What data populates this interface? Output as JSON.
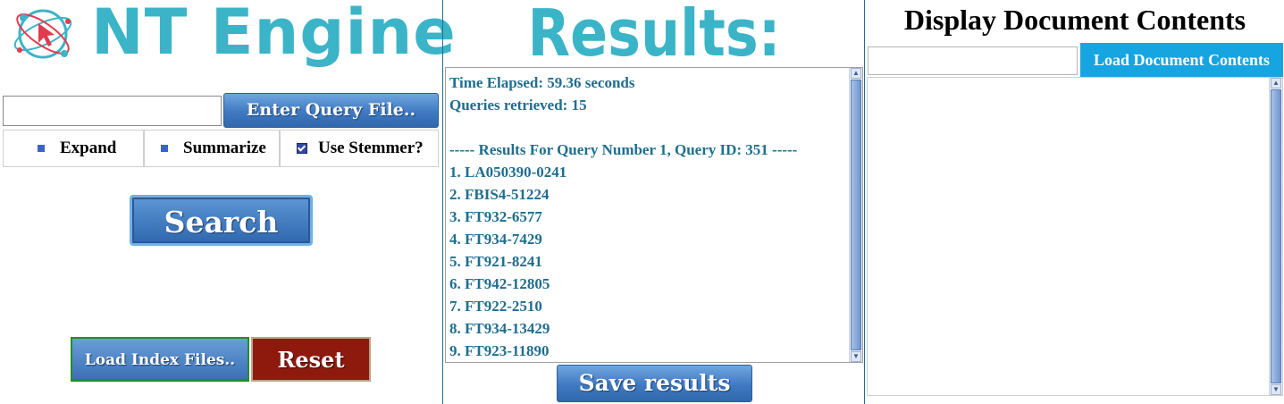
{
  "left": {
    "brand": "NT Engine",
    "query_placeholder": "",
    "enter_query_label": "Enter Query File..",
    "options": [
      {
        "label": "Expand",
        "checked": false
      },
      {
        "label": "Summarize",
        "checked": false
      },
      {
        "label": "Use Stemmer?",
        "checked": true
      }
    ],
    "search_label": "Search",
    "load_index_label": "Load Index Files..",
    "reset_label": "Reset"
  },
  "middle": {
    "title": "Results:",
    "results_lines": [
      "Time Elapsed: 59.36 seconds",
      "Queries retrieved: 15",
      "",
      "----- Results For Query Number 1, Query ID: 351 -----",
      "1. LA050390-0241",
      "2. FBIS4-51224",
      "3. FT932-6577",
      "4. FT934-7429",
      "5. FT921-8241",
      "6. FT942-12805",
      "7. FT922-2510",
      "8. FT934-13429",
      "9. FT923-11890"
    ],
    "save_label": "Save results"
  },
  "right": {
    "title": "Display Document Contents",
    "doc_input_placeholder": "",
    "load_doc_label": "Load Document Contents"
  },
  "colors": {
    "brand_teal": "#3bb4c8",
    "result_text": "#1f6e8f",
    "button_blue": "#3f79c1",
    "reset_red": "#8e1a0e",
    "load_doc_blue": "#16a5e0"
  }
}
